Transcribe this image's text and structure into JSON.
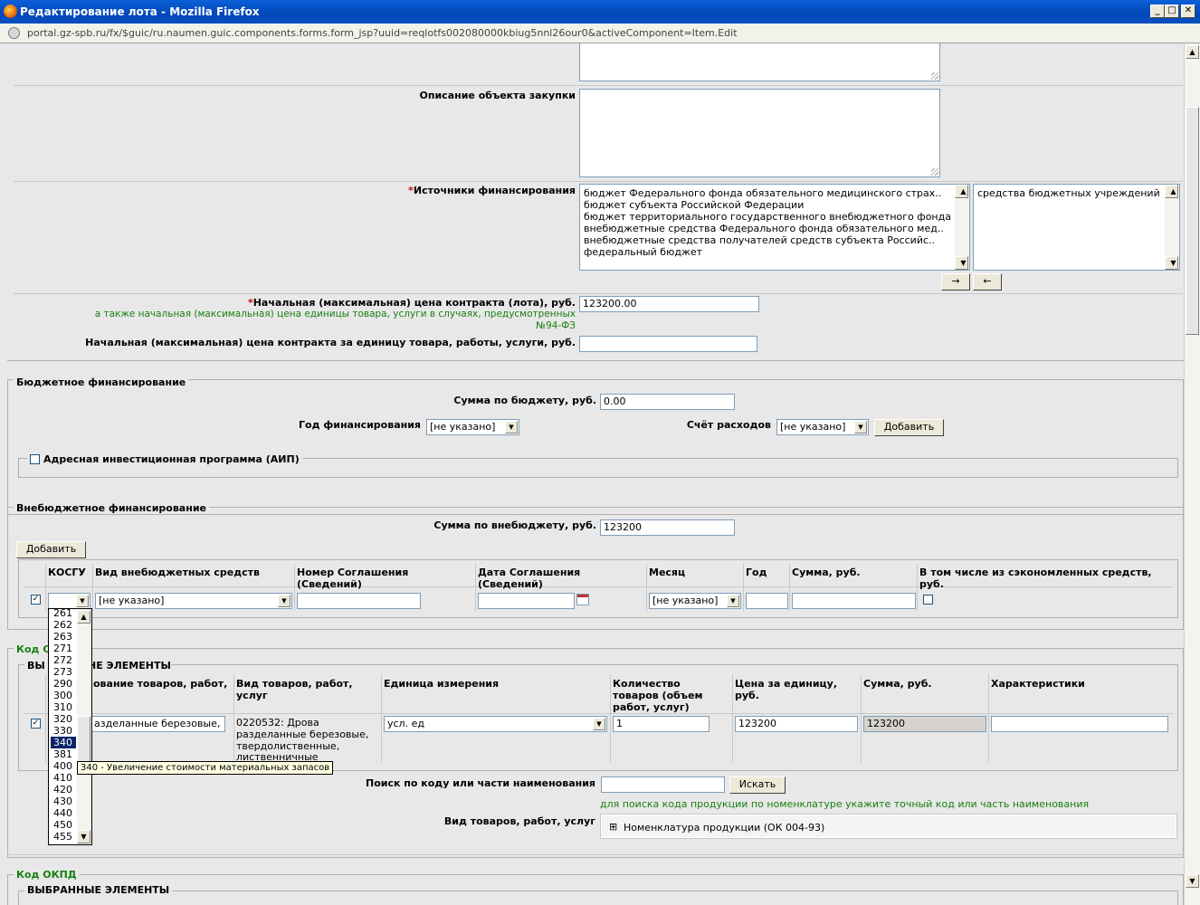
{
  "window": {
    "title": "Редактирование лота - Mozilla Firefox",
    "min": "_",
    "max": "□",
    "close": "✕"
  },
  "address": {
    "url": "portal.gz-spb.ru/fx/$guic/ru.naumen.guic.components.forms.form_jsp?uuid=reqlotfs002080000kbiug5nnl26our0&activeComponent=Item.Edit"
  },
  "lot": {
    "description_label": "Описание объекта закупки",
    "sources_label": "Источники финансирования",
    "required_mark": "*",
    "sources_available": [
      "бюджет Федерального фонда обязательного медицинского страх..",
      "бюджет субъекта Российской Федерации",
      "бюджет территориального государственного внебюджетного фонда",
      "внебюджетные средства Федерального фонда обязательного мед..",
      "внебюджетные средства получателей средств субъекта Российс..",
      "федеральный бюджет"
    ],
    "sources_selected": [
      "средства бюджетных учреждений"
    ],
    "move_right": "→",
    "move_left": "←",
    "price_label": "Начальная (максимальная) цена контракта (лота), руб.",
    "price_hint_line1": "а также начальная (максимальная) цена единицы товара, услуги в случаях, предусмотренных",
    "price_hint_line2": "№94-ФЗ",
    "price_value": "123200.00",
    "unit_price_label": "Начальная (максимальная) цена контракта за единицу товара, работы, услуги, руб.",
    "unit_price_value": ""
  },
  "budget": {
    "legend": "Бюджетное финансирование",
    "sum_label": "Сумма по бюджету, руб.",
    "sum_value": "0.00",
    "year_label": "Год финансирования",
    "year_value": "[не указано]",
    "account_label": "Счёт расходов",
    "account_value": "[не указано]",
    "add_button": "Добавить",
    "aip_label": "Адресная инвестиционная программа (АИП)"
  },
  "offbudget": {
    "legend": "Внебюджетное финансирование",
    "sum_label": "Сумма по внебюджету, руб.",
    "sum_value": "123200",
    "add_button": "Добавить",
    "columns": [
      "КОСГУ",
      "Вид внебюджетных средств",
      "Номер Соглашения",
      "(Сведений)",
      "Дата Соглашения",
      "(Сведений)",
      "Месяц",
      "Год",
      "Сумма, руб.",
      "В том числе из сэкономленных средств,",
      "руб."
    ],
    "row": {
      "checked": "✓",
      "kosgu": "",
      "kind": "[не указано]",
      "number": "",
      "date": "",
      "month": "[не указано]",
      "year": "",
      "sum": ""
    }
  },
  "kosgu_dropdown": {
    "options": [
      "261",
      "262",
      "263",
      "271",
      "272",
      "273",
      "290",
      "300",
      "310",
      "320",
      "330",
      "340",
      "381",
      "400",
      "410",
      "420",
      "430",
      "440",
      "450",
      "455"
    ],
    "selected": "340",
    "tooltip": "340 - Увеличение стоимости материальных запасов"
  },
  "okdp_section": {
    "legend_partial": "Код С",
    "selected_legend_partial": "ВЫ",
    "selected_legend_rest": "НЕ ЭЛЕМЕНТЫ",
    "columns": [
      "ование товаров, работ,",
      "Вид товаров, работ,",
      "услуг",
      "Единица измерения",
      "Количество",
      "товаров (объем",
      "работ, услуг)",
      "Цена за единицу,",
      "руб.",
      "Сумма, руб.",
      "Характеристики"
    ],
    "row": {
      "checked": "✓",
      "name": "азделанные березовые,",
      "kind_l1": "0220532: Дрова",
      "kind_l2": "разделанные березовые,",
      "kind_l3": "твердолиственные,",
      "kind_l4": "лиственничные",
      "unit": "усл. ед",
      "qty": "1",
      "price": "123200",
      "sum": "123200",
      "chars": ""
    },
    "search_label": "Поиск по коду или части наименования",
    "search_value": "",
    "search_button": "Искать",
    "search_hint": "для поиска кода продукции по номенклатуре укажите точный код или часть наименования",
    "kind_label": "Вид товаров, работ, услуг",
    "tree_expand": "⊞",
    "tree_item": "Номенклатура продукции (ОК 004-93)"
  },
  "okpd": {
    "legend": "Код ОКПД",
    "selected_partial": "ВЫБРАННЫЕ ЭЛЕМЕНТЫ"
  }
}
